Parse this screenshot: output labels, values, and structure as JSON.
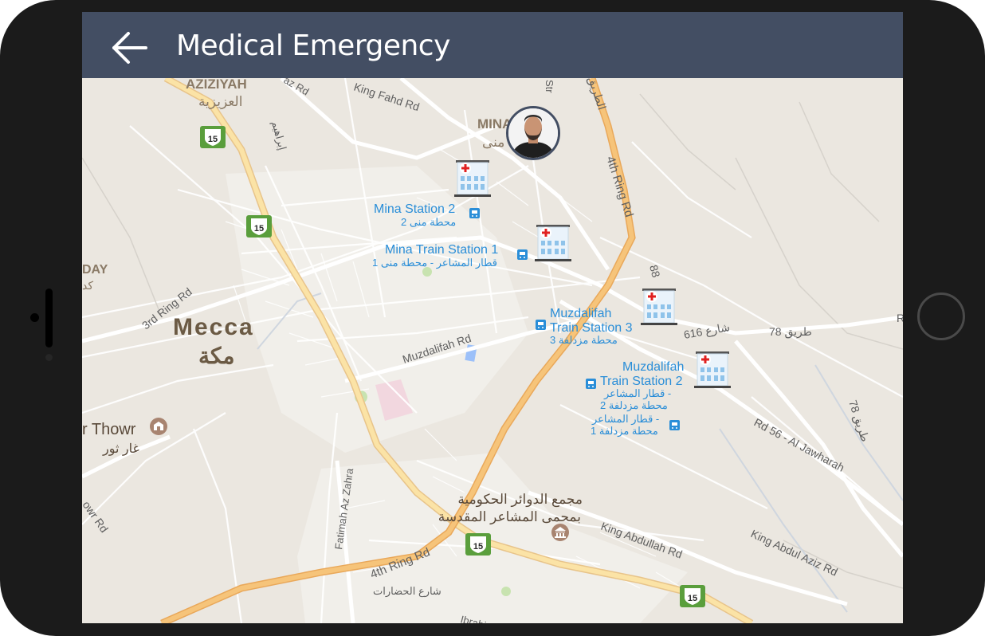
{
  "app": {
    "title": "Medical Emergency"
  },
  "map": {
    "city_labels": {
      "mecca_en": "Mecca",
      "mecca_ar": "مكة",
      "mina_en": "MINA",
      "mina_ar": "منى",
      "aziziyah_en": "AZIZIYAH",
      "aziziyah_ar": "العزيزية",
      "day_partial": "DAY",
      "day_ar_partial": "كد"
    },
    "stations": {
      "mina2_en": "Mina Station 2",
      "mina2_ar": "محطة منى 2",
      "mina1_en": "Mina Train Station 1",
      "mina1_ar": "قطار المشاعر - محطة منى 1",
      "muz3_en_1": "Muzdalifah",
      "muz3_en_2": "Train Station 3",
      "muz3_ar": "محطة مزدلفة 3",
      "muz2_en_1": "Muzdalifah",
      "muz2_en_2": "Train Station 2",
      "muz2_ar_1": "قطار المشاعر -",
      "muz2_ar_2": "محطة مزدلفة 2",
      "muz1_ar_1": "قطار المشاعر -",
      "muz1_ar_2": "محطة مزدلفة 1"
    },
    "roads": {
      "king_fahd": "King Fahd Rd",
      "str_partial": "Str",
      "ring4_a": "4th Ring Rd",
      "ring4_b": "4th Ring Rd",
      "ring4_ar": "الطريق",
      "ring3": "3rd Ring Rd",
      "muzdalifah_rd": "Muzdalifah Rd",
      "r88": "88",
      "r616_ar": "شارع 616",
      "r78_ar": "طريق 78",
      "r78_ar_b": "طريق 78",
      "r_partial": "R",
      "rd56": "Rd 56 - Al Jawharah",
      "king_abdullah": "King Abdullah Rd",
      "king_abdul_aziz": "King Abdul Aziz Rd",
      "fatimah": "Fatimah Az Zahra",
      "thowr_rd_partial": "owr Rd",
      "hadarat_ar": "شارع الحضارات",
      "ibrahim_partial": "Ibrahi",
      "az_partial": "az Rd",
      "ibrahim_ar_partial": "إبراهيم"
    },
    "pois": {
      "thowr_en": "r Thowr",
      "thowr_ar": "غار ثور",
      "gov_complex_ar_1": "مجمع الدوائر الحكومية",
      "gov_complex_ar_2": "بمحمى المشاعر المقدسة"
    },
    "shields": {
      "route": "15"
    }
  },
  "colors": {
    "appbar": "#434e63",
    "map_bg": "#ebe7e0",
    "highway": "#f4c274",
    "station_label": "#2a8ed8",
    "hospital_red": "#e02020"
  }
}
